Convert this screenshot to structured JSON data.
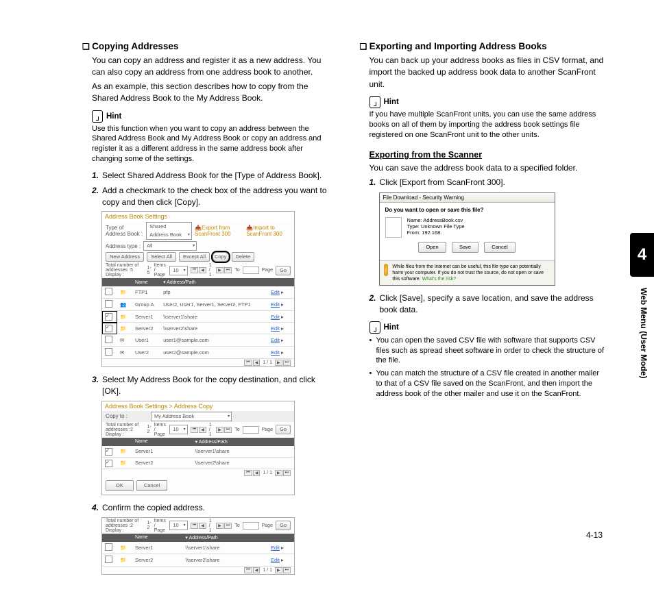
{
  "chapterTab": "4",
  "sideLabel": "Web Menu (User Mode)",
  "pageNumber": "4-13",
  "left": {
    "heading": "Copying Addresses",
    "intro1": "You can copy an address and register it as a new address. You can also copy an address from one address book to another.",
    "intro2": "As an example, this section describes how to copy from the Shared Address Book to the My Address Book.",
    "hintLabel": "Hint",
    "hintText": "Use this function when you want to copy an address between the Shared Address Book and My Address Book or copy an address and register it as a different address in the same address book after changing some of the settings.",
    "step1": "Select Shared Address Book for the [Type of Address Book].",
    "step2": "Add a checkmark to the check box of the address you want to copy and then click [Copy].",
    "step3": "Select My Address Book for the copy destination, and click [OK].",
    "step4": "Confirm the copied address.",
    "ui1": {
      "title": "Address Book Settings",
      "typeLabel": "Type of Address Book :",
      "typeValue": "Shared Address Book",
      "exportLink": "Export from ScanFront 300",
      "importLink": "Import to ScanFront 300",
      "addrTypeLabel": "Address type :",
      "addrTypeValue": "All",
      "btnNew": "New Address",
      "btnSelectAll": "Select All",
      "btnExceptAll": "Except All",
      "btnCopy": "Copy",
      "btnDelete": "Delete",
      "totalLabel": "Total number of addresses :5 Display :",
      "range": "1-5",
      "itemsPage": "Items / Page",
      "itemsVal": "10",
      "pageInfo": "1 / 1",
      "toLabel": "To",
      "pageLabel": "Page",
      "goBtn": "Go",
      "colName": "Name",
      "colAddr": "Address/Path",
      "editLabel": "Edit",
      "rows": [
        {
          "name": "FTP1",
          "addr": "pfp",
          "check": false
        },
        {
          "name": "Group A",
          "addr": "User2, User1, Server1, Server2, FTP1",
          "check": false
        },
        {
          "name": "Server1",
          "addr": "\\\\server1\\share",
          "check": true
        },
        {
          "name": "Server2",
          "addr": "\\\\server2\\share",
          "check": true
        },
        {
          "name": "User1",
          "addr": "user1@sample.com",
          "check": false
        },
        {
          "name": "User2",
          "addr": "user2@sample.com",
          "check": false
        }
      ]
    },
    "ui2": {
      "title": "Address Book Settings > Address Copy",
      "copyTo": "Copy to :",
      "copyDest": "My Address Book",
      "totalLabel": "Total number of addresses :2 Display :",
      "range": "1-2",
      "rows": [
        {
          "name": "Server1",
          "addr": "\\\\server1\\share",
          "check": true
        },
        {
          "name": "Server2",
          "addr": "\\\\server2\\share",
          "check": true
        }
      ],
      "btnOk": "OK",
      "btnCancel": "Cancel"
    },
    "ui3": {
      "totalLabel": "Total number of addresses :2 Display :",
      "range": "1-2",
      "rows": [
        {
          "name": "Server1",
          "addr": "\\\\server1\\share",
          "check": false
        },
        {
          "name": "Server2",
          "addr": "\\\\server2\\share",
          "check": false
        }
      ]
    }
  },
  "right": {
    "heading": "Exporting and Importing Address Books",
    "intro": "You can back up your address books as files in CSV format, and import the backed up address book data to another ScanFront unit.",
    "hintLabel": "Hint",
    "hint1": "If you have multiple ScanFront units, you can use the same address books on all of them by importing the address book settings file registered on one ScanFront unit to the other units.",
    "subheading": "Exporting from the Scanner",
    "subIntro": "You can save the address book data to a specified folder.",
    "step1": "Click [Export from ScanFront 300].",
    "step2": "Click [Save], specify a save location, and save the address book data.",
    "dialog": {
      "title": "File Download - Security Warning",
      "question": "Do you want to open or save this file?",
      "nameLabel": "Name:",
      "nameVal": "AddressBook.csv",
      "typeLabel": "Type:",
      "typeVal": "Unknown File Type",
      "fromLabel": "From:",
      "fromVal": "192.168.",
      "btnOpen": "Open",
      "btnSave": "Save",
      "btnCancel": "Cancel",
      "warning": "While files from the Internet can be useful, this file type can potentially harm your computer. If you do not trust the source, do not open or save this software.",
      "riskLink": "What's the risk?"
    },
    "hint2Label": "Hint",
    "bullet1": "You can open the saved CSV file with software that supports CSV files such as spread sheet software in order to check the structure of the file.",
    "bullet2": "You can match the structure of a CSV file created in another mailer to that of a CSV file saved on the ScanFront, and then import the address book of the other mailer and use it on the ScanFront."
  }
}
